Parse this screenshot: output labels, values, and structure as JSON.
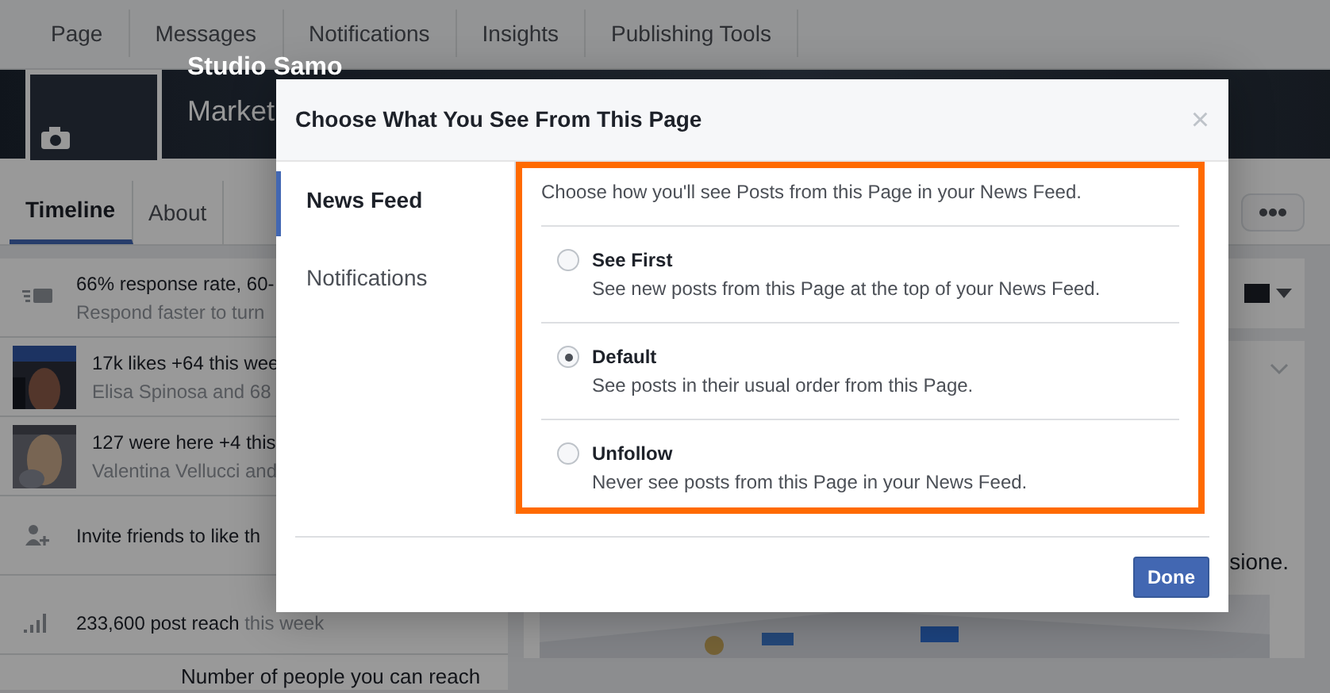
{
  "top_nav": {
    "tabs": [
      {
        "label": "Page"
      },
      {
        "label": "Messages"
      },
      {
        "label": "Notifications"
      },
      {
        "label": "Insights"
      },
      {
        "label": "Publishing Tools"
      }
    ]
  },
  "cover": {
    "page_name": "Studio Samo",
    "category": "Market"
  },
  "page_tabs": [
    {
      "label": "Timeline",
      "selected": true
    },
    {
      "label": "About",
      "selected": false
    }
  ],
  "sidebar_rows": [
    {
      "kind": "response",
      "title": "66% response rate, 60-",
      "subtitle": "Respond faster to turn"
    },
    {
      "kind": "picture",
      "title": "17k likes +64 this wee",
      "subtitle": "Elisa Spinosa and 68"
    },
    {
      "kind": "picture",
      "title": "127 were here +4 this",
      "subtitle": "Valentina Vellucci and"
    },
    {
      "kind": "invite",
      "title": "Invite friends to like th"
    },
    {
      "kind": "reach",
      "title": "233,600 post reach",
      "suffix": "this week"
    }
  ],
  "reach_note": "Number of people you can reach",
  "post_text": "sione.",
  "dialog": {
    "title": "Choose What You See From This Page",
    "close": "×",
    "sections": [
      {
        "label": "News Feed",
        "selected": true
      },
      {
        "label": "Notifications",
        "selected": false
      }
    ],
    "intro": "Choose how you'll see Posts from this Page in your News Feed.",
    "options": [
      {
        "label": "See First",
        "description": "See new posts from this Page at the top of your News Feed.",
        "selected": false
      },
      {
        "label": "Default",
        "description": "See posts in their usual order from this Page.",
        "selected": true
      },
      {
        "label": "Unfollow",
        "description": "Never see posts from this Page in your News Feed.",
        "selected": false
      }
    ],
    "done": "Done"
  }
}
